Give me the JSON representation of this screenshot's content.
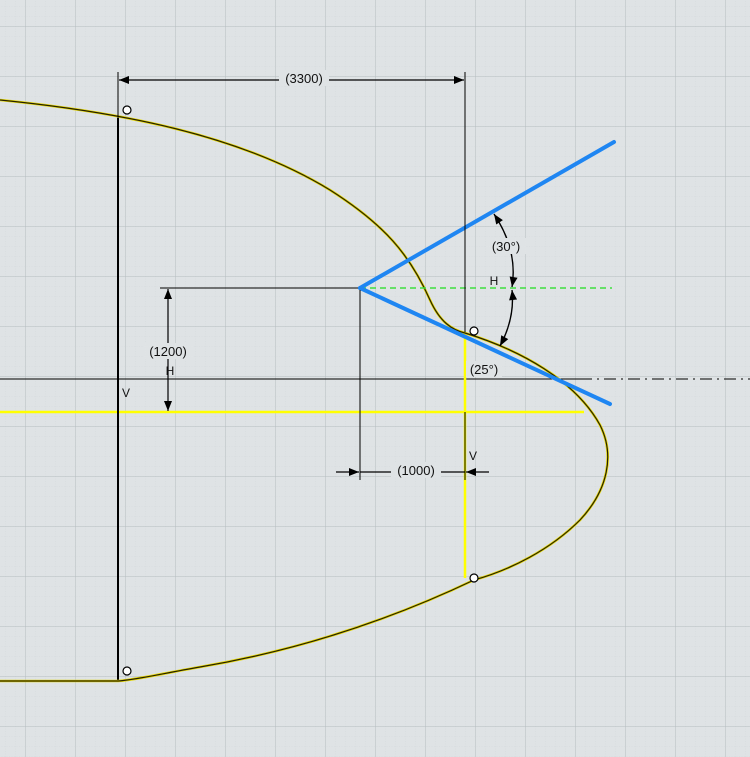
{
  "dimensions": {
    "horizontal_distance": "(3300)",
    "vertical_distance": "(1200)",
    "offset_distance": "(1000)",
    "upper_angle": "(30°)",
    "lower_angle": "(25°)"
  },
  "constraints": {
    "horizontal": "H",
    "vertical": "V"
  },
  "colors": {
    "background": "#dfe3e5",
    "grid_minor": "#c9cfd2",
    "grid_major": "#b6bec2",
    "profile_curve": "#262000",
    "profile_curve_edge": "#e0d200",
    "construction_yellow": "#ffff00",
    "blue_lines": "#1f86f2",
    "green_dashed": "#3ee03e",
    "black": "#000000"
  }
}
